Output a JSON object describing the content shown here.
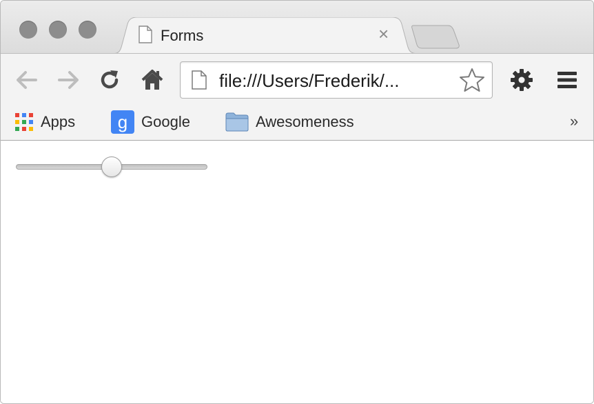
{
  "window": {
    "controls": [
      "close",
      "minimize",
      "zoom"
    ]
  },
  "tab": {
    "title": "Forms",
    "icon": "page-icon",
    "close_glyph": "×"
  },
  "toolbar": {
    "back_icon": "arrow-left-icon",
    "forward_icon": "arrow-right-icon",
    "reload_icon": "reload-icon",
    "home_icon": "home-icon",
    "address": "file:///Users/Frederik/...",
    "star_icon": "star-icon",
    "settings_icon": "gear-icon",
    "menu_icon": "hamburger-icon"
  },
  "bookmarks": {
    "items": [
      {
        "label": "Apps",
        "icon": "apps-grid-icon"
      },
      {
        "label": "Google",
        "icon": "google-icon"
      },
      {
        "label": "Awesomeness",
        "icon": "folder-icon"
      }
    ],
    "overflow": "»"
  },
  "content": {
    "slider": {
      "value_fraction": 0.5
    }
  },
  "colors": {
    "google_blue": "#4285f4",
    "folder_blue": "#8fb3da"
  }
}
